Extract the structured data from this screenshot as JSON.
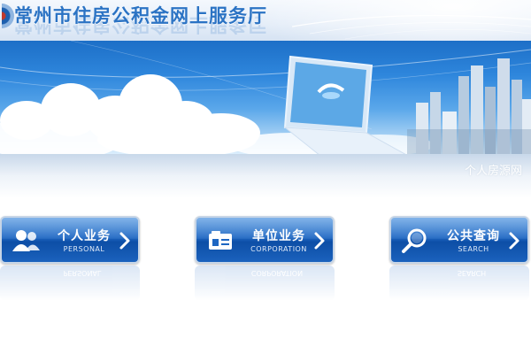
{
  "header": {
    "site_title": "常州市住房公积金网上服务厅",
    "logo_icon": "emblem-icon"
  },
  "banner": {
    "illustrations": [
      "clouds",
      "laptop-icon",
      "city-skyline"
    ]
  },
  "subtitle": "个人房源网",
  "nav": {
    "personal": {
      "label": "个人业务",
      "sublabel": "PERSONAL",
      "icon": "users-icon"
    },
    "corporation": {
      "label": "单位业务",
      "sublabel": "CORPORATION",
      "icon": "id-card-icon"
    },
    "search": {
      "label": "公共查询",
      "sublabel": "SEARCH",
      "icon": "magnifier-icon"
    }
  },
  "colors": {
    "title_blue": "#2b73c4",
    "button_blue": "#1d66c2",
    "banner_sky": "#2e86dc"
  }
}
